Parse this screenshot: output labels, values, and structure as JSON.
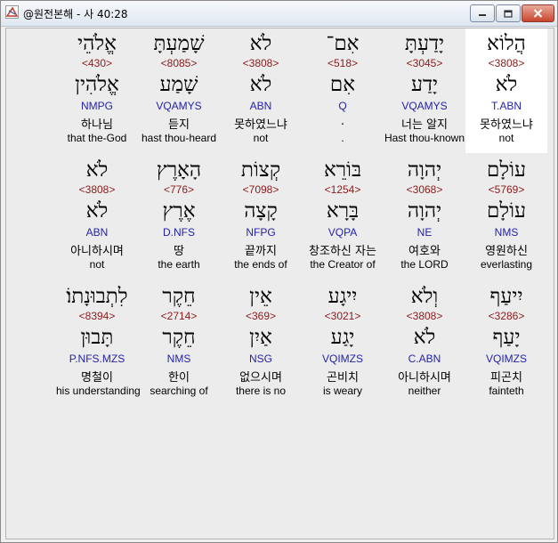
{
  "window": {
    "title": "@원전본해 - 사 40:28"
  },
  "rows": [
    [
      {
        "heb": "הֲלוֹא",
        "num": "<3808>",
        "lemma": "לֹא",
        "parse": "T.ABN",
        "kor": "못하였느냐",
        "eng": "not",
        "highlight": true
      },
      {
        "heb": "יָדַעְתָּ",
        "num": "<3045>",
        "lemma": "יָדַע",
        "parse": "VQAMYS",
        "kor": "너는 알지",
        "eng": "Hast thou-known"
      },
      {
        "heb": "אִם־",
        "num": "<518>",
        "lemma": "אִם",
        "parse": "Q",
        "kor": ".",
        "eng": "."
      },
      {
        "heb": "לֹא",
        "num": "<3808>",
        "lemma": "לֹא",
        "parse": "ABN",
        "kor": "못하였느냐",
        "eng": "not"
      },
      {
        "heb": "שָׁמַעְתָּ",
        "num": "<8085>",
        "lemma": "שָׁמַע",
        "parse": "VQAMYS",
        "kor": "듣지",
        "eng": "hast thou-heard"
      },
      {
        "heb": "אֱלֹהֵי",
        "num": "<430>",
        "lemma": "אֱלֹהִין",
        "parse": "NMPG",
        "kor": "하나님",
        "eng": "that the-God"
      }
    ],
    [
      {
        "heb": "עוֹלָם",
        "num": "<5769>",
        "lemma": "עוֹלָם",
        "parse": "NMS",
        "kor": "영원하신",
        "eng": "everlasting"
      },
      {
        "heb": "יְהוָה",
        "num": "<3068>",
        "lemma": "יְהוָה",
        "parse": "NE",
        "kor": "여호와",
        "eng": "the LORD"
      },
      {
        "heb": "בּוֹרֵא",
        "num": "<1254>",
        "lemma": "בָּרָא",
        "parse": "VQPA",
        "kor": "창조하신 자는",
        "eng": "the Creator of"
      },
      {
        "heb": "קְצוֹת",
        "num": "<7098>",
        "lemma": "קָצָה",
        "parse": "NFPG",
        "kor": "끝까지",
        "eng": "the ends of"
      },
      {
        "heb": "הָאָרֶץ",
        "num": "<776>",
        "lemma": "אֶרֶץ",
        "parse": "D.NFS",
        "kor": "땅",
        "eng": "the earth"
      },
      {
        "heb": "לֹא",
        "num": "<3808>",
        "lemma": "לֹא",
        "parse": "ABN",
        "kor": "아니하시며",
        "eng": "not"
      }
    ],
    [
      {
        "heb": "יִיעַף",
        "num": "<3286>",
        "lemma": "יָעַף",
        "parse": "VQIMZS",
        "kor": "피곤치",
        "eng": "fainteth"
      },
      {
        "heb": "וְלֹא",
        "num": "<3808>",
        "lemma": "לֹא",
        "parse": "C.ABN",
        "kor": "아니하시며",
        "eng": "neither"
      },
      {
        "heb": "יִיגָע",
        "num": "<3021>",
        "lemma": "יָגַע",
        "parse": "VQIMZS",
        "kor": "곤비치",
        "eng": "is weary"
      },
      {
        "heb": "אֵין",
        "num": "<369>",
        "lemma": "אַיִן",
        "parse": "NSG",
        "kor": "없으시며",
        "eng": "there is no"
      },
      {
        "heb": "חֵקֶר",
        "num": "<2714>",
        "lemma": "חֵקֶר",
        "parse": "NMS",
        "kor": "한이",
        "eng": "searching of"
      },
      {
        "heb": "לִתְבוּנָתוֹ׃",
        "num": "<8394>",
        "lemma": "תָּבוּן",
        "parse": "P.NFS.MZS",
        "kor": "명철이",
        "eng": "his understanding"
      }
    ]
  ]
}
